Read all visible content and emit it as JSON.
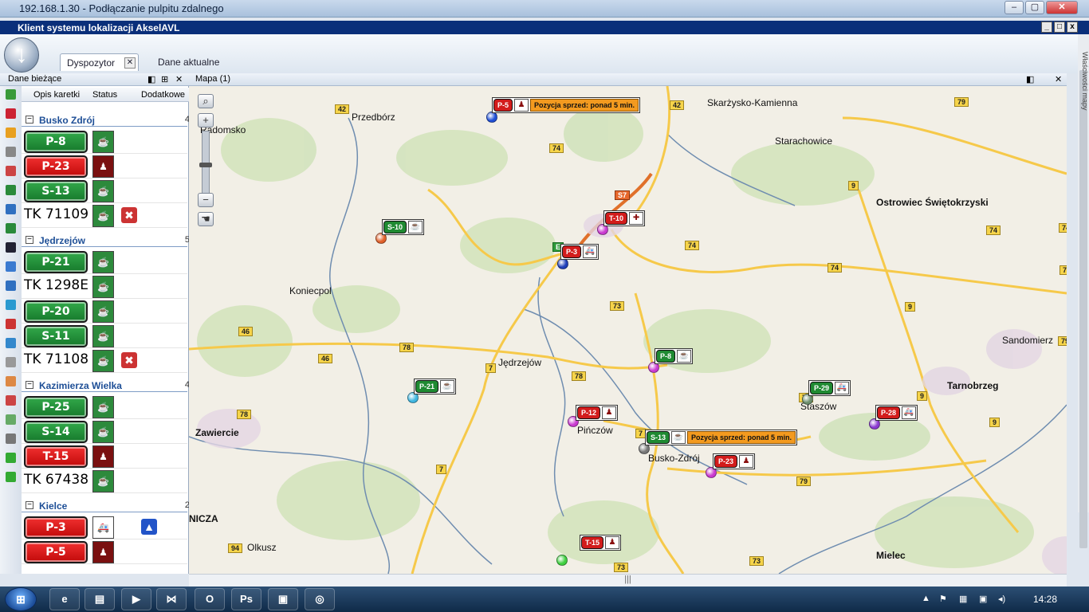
{
  "rdp": {
    "title": "192.168.1.30 - Podłączanie pulpitu zdalnego",
    "min": "–",
    "max": "▢",
    "close": "✕"
  },
  "app": {
    "title": "Klient systemu lokalizacji AkselAVL",
    "min": "_",
    "max": "□",
    "close": "x"
  },
  "ribbon": {
    "tab_dispatcher": "Dyspozytor",
    "tab_current": "Dane aktualne",
    "tab_close": "✕",
    "arrow": "↓"
  },
  "panel": {
    "title": "Dane bieżące",
    "pin": "◧",
    "dock": "⊞",
    "close": "✕",
    "columns": {
      "desc": "Opis karetki",
      "status": "Status",
      "extra": "Dodatkowe"
    },
    "groups": [
      {
        "name": "Busko Zdrój",
        "count": "4",
        "toggle": "−",
        "rows": [
          {
            "tag": "P-8",
            "color": "green",
            "status": "cup"
          },
          {
            "tag": "P-23",
            "color": "red",
            "status": "person",
            "extra": [
              "monitor"
            ]
          },
          {
            "tag": "S-13",
            "color": "green",
            "status": "cup"
          },
          {
            "plain": "TK 71109",
            "status": "cup",
            "extra": [
              "x"
            ]
          }
        ]
      },
      {
        "name": "Jędrzejów",
        "count": "5",
        "toggle": "−",
        "rows": [
          {
            "tag": "P-21",
            "color": "green",
            "status": "cup"
          },
          {
            "plain": "TK 1298E",
            "status": "cup"
          },
          {
            "tag": "P-20",
            "color": "green",
            "status": "cup"
          },
          {
            "tag": "S-11",
            "color": "green",
            "status": "cup"
          },
          {
            "plain": "TK 71108",
            "status": "cup",
            "extra": [
              "x"
            ]
          }
        ]
      },
      {
        "name": "Kazimierza Wielka",
        "count": "4",
        "toggle": "−",
        "rows": [
          {
            "tag": "P-25",
            "color": "green",
            "status": "cup"
          },
          {
            "tag": "S-14",
            "color": "green",
            "status": "cup"
          },
          {
            "tag": "T-15",
            "color": "red",
            "status": "person",
            "extra": [
              "monitor"
            ]
          },
          {
            "plain": "TK 67438",
            "status": "cup"
          }
        ]
      },
      {
        "name": "Kielce",
        "count": "2",
        "toggle": "−",
        "rows": [
          {
            "tag": "P-3",
            "color": "red",
            "status": "ambulance",
            "extra": [
              "monitor",
              "siren"
            ]
          },
          {
            "tag": "P-5",
            "color": "red",
            "status": "person",
            "extra": [
              "monitor"
            ]
          }
        ]
      }
    ]
  },
  "map": {
    "title": "Mapa (1)",
    "max": "◧",
    "close": "✕",
    "places": [
      {
        "name": "Skarżysko-Kamienna",
        "bold": false
      },
      {
        "name": "Przedbórz",
        "bold": false
      },
      {
        "name": "Radomsko",
        "bold": false
      },
      {
        "name": "Starachowice",
        "bold": false
      },
      {
        "name": "Ostrowiec Świętokrzyski",
        "bold": true
      },
      {
        "name": "Koniecpol",
        "bold": false
      },
      {
        "name": "Sandomierz",
        "bold": false
      },
      {
        "name": "Tarnobrzeg",
        "bold": true
      },
      {
        "name": "Jędrzejów",
        "bold": false
      },
      {
        "name": "Staszów",
        "bold": false
      },
      {
        "name": "Zawiercie",
        "bold": true
      },
      {
        "name": "Pińczów",
        "bold": false
      },
      {
        "name": "Busko-Zdrój",
        "bold": false
      },
      {
        "name": "NICZA",
        "bold": true
      },
      {
        "name": "Olkusz",
        "bold": false
      },
      {
        "name": "Mielec",
        "bold": true
      }
    ],
    "roads": [
      "42",
      "42",
      "79",
      "74",
      "S7",
      "9",
      "74",
      "74",
      "74",
      "E",
      "74",
      "73",
      "9",
      "46",
      "78",
      "46",
      "7",
      "78",
      "78",
      "79",
      "9",
      "9",
      "78",
      "7",
      "7",
      "79",
      "94",
      "73",
      "73",
      "79"
    ],
    "vehicles": [
      {
        "tag": "P-5",
        "color": "red",
        "icon": "person",
        "warn": "Pozycja sprzed: ponad 5 min.",
        "pin": "#1f4fd6"
      },
      {
        "tag": "S-10",
        "color": "green",
        "icon": "cup",
        "pin": "#e0602a"
      },
      {
        "tag": "T-10",
        "color": "red",
        "icon": "cross",
        "pin": "#c93ad0"
      },
      {
        "tag": "P-3",
        "color": "red",
        "icon": "ambulance",
        "pin": "#1f3fb8"
      },
      {
        "tag": "P-8",
        "color": "green",
        "icon": "cup",
        "pin": "#c93ad0"
      },
      {
        "tag": "P-21",
        "color": "green",
        "icon": "cup",
        "pin": "#3fb6e0"
      },
      {
        "tag": "P-29",
        "color": "green",
        "icon": "ambulance",
        "pin": "#6b8d6b"
      },
      {
        "tag": "P-28",
        "color": "red",
        "icon": "ambulance",
        "pin": "#8a3ad0"
      },
      {
        "tag": "P-12",
        "color": "red",
        "icon": "person",
        "pin": "#c93ad0"
      },
      {
        "tag": "S-13",
        "color": "green",
        "icon": "cup",
        "warn": "Pozycja sprzed: ponad 5 min.",
        "pin": "#777777"
      },
      {
        "tag": "P-23",
        "color": "red",
        "icon": "person",
        "pin": "#c93ad0"
      },
      {
        "tag": "T-15",
        "color": "red",
        "icon": "person",
        "pin": "#3fd040"
      }
    ]
  },
  "side_tab": "Właściwości mapy",
  "scroll": "|||",
  "taskbar": {
    "start": "⊞",
    "time": "14:28",
    "buttons": [
      "e",
      "▤",
      "▶",
      "⋈",
      "O",
      "Ps",
      "▣",
      "◎"
    ],
    "tray": [
      "▲",
      "⚑",
      "▦",
      "▣",
      "◂)"
    ]
  }
}
